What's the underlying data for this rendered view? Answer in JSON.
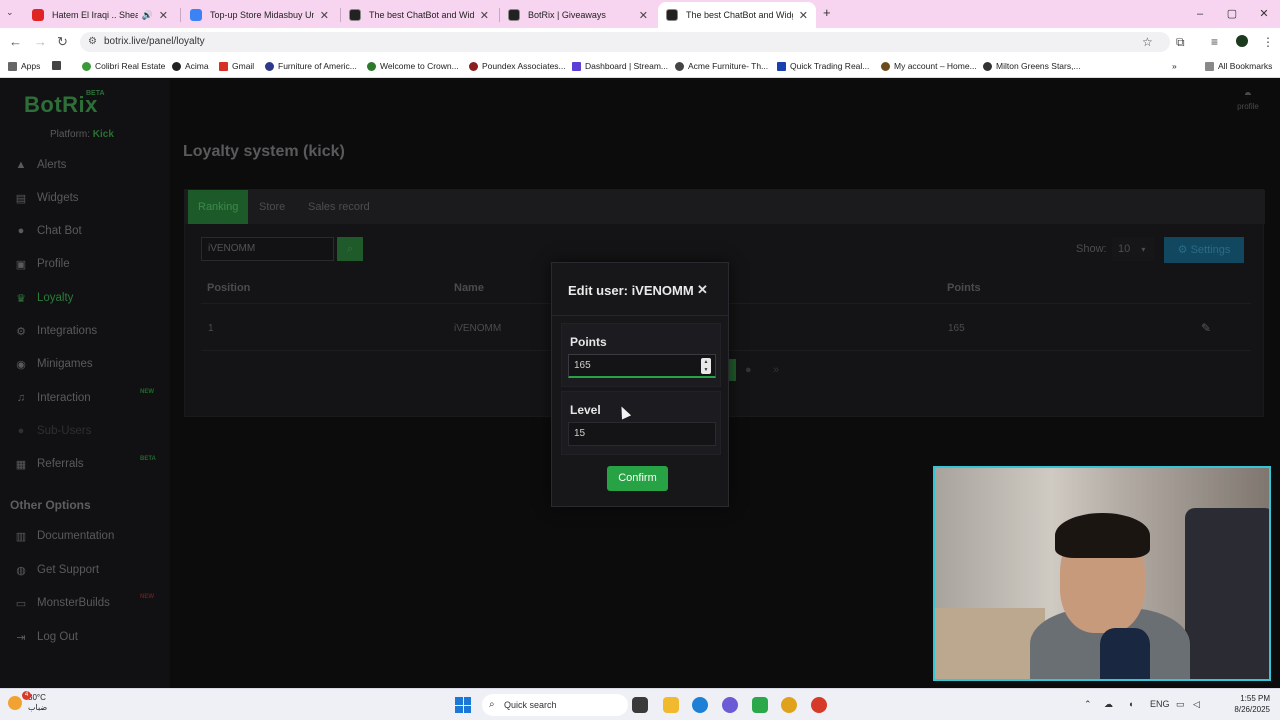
{
  "browser": {
    "tabs": [
      {
        "title": "Hatem El Iraqi .. Shealoma",
        "icon_color": "#e02424",
        "icon": "youtube-icon"
      },
      {
        "title": "Top-up Store Midasbuy United",
        "icon_color": "#3b82f6",
        "icon": "midasbuy-icon"
      },
      {
        "title": "The best ChatBot and Widgets",
        "icon_color": "#222222",
        "icon": "botrix-icon"
      },
      {
        "title": "BotRix | Giveaways",
        "icon_color": "#222222",
        "icon": "botrix-icon"
      },
      {
        "title": "The best ChatBot and Widgets",
        "icon_color": "#222222",
        "icon": "botrix-icon"
      }
    ],
    "new_tab": "+",
    "window_controls": [
      "–",
      "▢",
      "✕"
    ],
    "url": "botrix.live/panel/loyalty",
    "bookmarks": [
      {
        "label": "Apps",
        "color": "#666666"
      },
      {
        "label": "Colibri Real Estate",
        "color": "#3a9a3a"
      },
      {
        "label": "Acima",
        "color": "#222222"
      },
      {
        "label": "Gmail",
        "color": "#d93025"
      },
      {
        "label": "Furniture of Americ...",
        "color": "#2d3a8c"
      },
      {
        "label": "Welcome to Crown...",
        "color": "#2a7a2a"
      },
      {
        "label": "Poundex Associates...",
        "color": "#8a1f1f"
      },
      {
        "label": "Dashboard | Stream...",
        "color": "#5b3fd6"
      },
      {
        "label": "Acme Furniture- Th...",
        "color": "#444444"
      },
      {
        "label": "Quick Trading Real...",
        "color": "#1a3fb0"
      },
      {
        "label": "My account – Home...",
        "color": "#6b4b1b"
      },
      {
        "label": "Milton Greens Stars,...",
        "color": "#333333"
      }
    ],
    "all_bookmarks": "All Bookmarks"
  },
  "app": {
    "logo": "BotRix",
    "logo_badge": "BETA",
    "platform_label": "Platform:",
    "platform_value": "Kick",
    "profile_label": "profile",
    "sidebar": [
      {
        "label": "Alerts",
        "icon": "alert-icon"
      },
      {
        "label": "Widgets",
        "icon": "widgets-icon"
      },
      {
        "label": "Chat Bot",
        "icon": "chatbot-icon"
      },
      {
        "label": "Profile",
        "icon": "profile-icon"
      },
      {
        "label": "Loyalty",
        "icon": "trophy-icon"
      },
      {
        "label": "Integrations",
        "icon": "integrations-icon"
      },
      {
        "label": "Minigames",
        "icon": "gamepad-icon"
      },
      {
        "label": "Interaction",
        "icon": "music-icon"
      },
      {
        "label": "Sub-Users",
        "icon": "users-icon"
      },
      {
        "label": "Referrals",
        "icon": "referrals-icon"
      }
    ],
    "badges": {
      "interaction": "NEW",
      "referrals": "BETA",
      "monsterbuilds": "NEW"
    },
    "other_options_title": "Other Options",
    "other_options": [
      {
        "label": "Documentation",
        "icon": "book-icon"
      },
      {
        "label": "Get Support",
        "icon": "support-icon"
      },
      {
        "label": "MonsterBuilds",
        "icon": "monitor-icon"
      },
      {
        "label": "Log Out",
        "icon": "logout-icon"
      }
    ]
  },
  "main": {
    "title": "Loyalty system (kick)",
    "tabs": [
      "Ranking",
      "Store",
      "Sales record"
    ],
    "search_value": "iVENOMM",
    "show_label": "Show:",
    "show_value": "10",
    "settings_label": "Settings",
    "columns": [
      "Position",
      "Name",
      "Points"
    ],
    "rows": [
      {
        "position": "1",
        "name": "iVENOMM",
        "points": "165"
      }
    ],
    "pager": {
      "first": "«",
      "last": "»",
      "dot": "●"
    }
  },
  "modal": {
    "title": "Edit user: iVENOMM",
    "close": "✕",
    "points_label": "Points",
    "points_value": "165",
    "level_label": "Level",
    "level_value": "15",
    "confirm_label": "Confirm"
  },
  "taskbar": {
    "temperature": "30°C",
    "weather_desc": "ضباب",
    "weather_badge": "4",
    "search_placeholder": "Quick search",
    "language": "ENG",
    "time": "1:55 PM",
    "date": "8/26/2025"
  }
}
